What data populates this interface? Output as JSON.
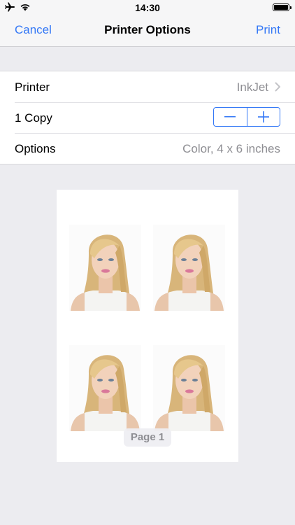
{
  "status_bar": {
    "time": "14:30",
    "left_icons": [
      "airplane-icon",
      "wifi-icon"
    ],
    "battery_icon": "battery-icon"
  },
  "nav": {
    "left_button": "Cancel",
    "title": "Printer Options",
    "right_button": "Print",
    "accent_color": "#3478f6"
  },
  "rows": {
    "printer": {
      "label": "Printer",
      "value": "InkJet"
    },
    "copies": {
      "label": "1 Copy",
      "minus_icon": "minus-icon",
      "plus_icon": "plus-icon"
    },
    "options": {
      "label": "Options",
      "value": "Color, 4 x 6 inches"
    }
  },
  "preview": {
    "page_label": "Page 1",
    "photos": [
      "portrait-photo",
      "portrait-photo",
      "portrait-photo",
      "portrait-photo"
    ]
  }
}
